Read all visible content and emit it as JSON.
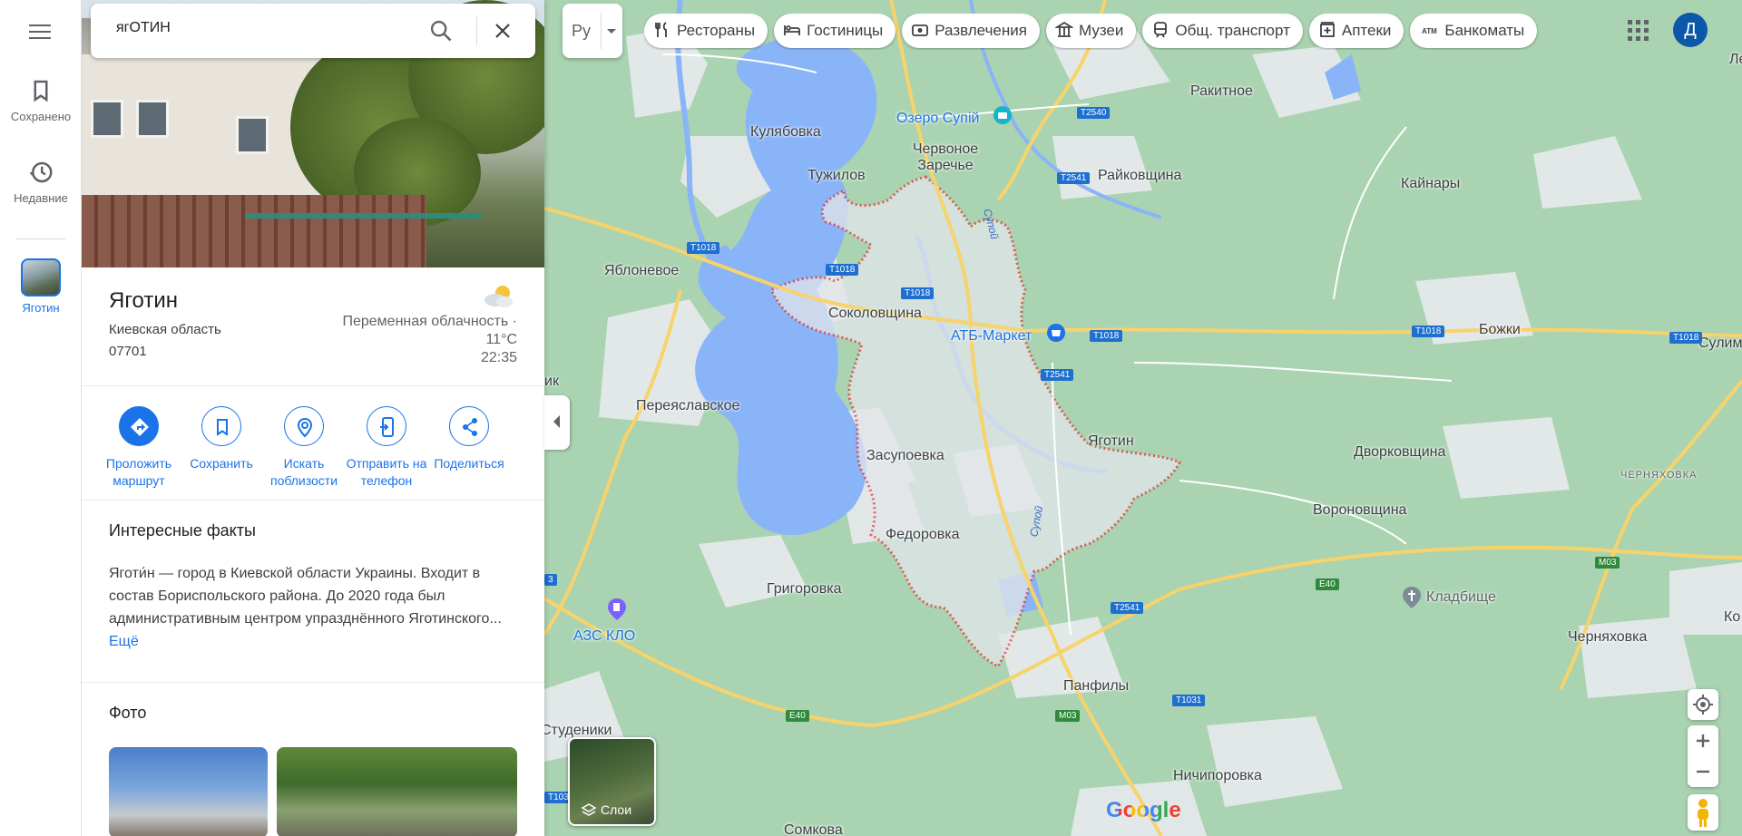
{
  "search": {
    "value": "ягОТИН"
  },
  "rail": {
    "saved_label": "Сохранено",
    "recent_label": "Недавние",
    "place_label": "Яготин"
  },
  "place": {
    "name": "Яготин",
    "region": "Киевская область",
    "postal_code": "07701",
    "weather_text": "Переменная облачность · 11°C",
    "time": "22:35"
  },
  "actions": [
    {
      "label": "Проложить маршрут",
      "icon": "directions-icon"
    },
    {
      "label": "Сохранить",
      "icon": "bookmark-icon"
    },
    {
      "label": "Искать поблизости",
      "icon": "nearby-icon"
    },
    {
      "label": "Отправить на телефон",
      "icon": "send-to-phone-icon"
    },
    {
      "label": "Поделиться",
      "icon": "share-icon"
    }
  ],
  "facts": {
    "heading": "Интересные факты",
    "text": "Яготи́н — город в Киевской области Украины. Входит в состав Бориспольского района. До 2020 года был административным центром упразднённого Яготинского...",
    "more": "Ещё"
  },
  "photos": {
    "heading": "Фото"
  },
  "map": {
    "language_button": "Ру",
    "chips": [
      {
        "label": "Рестораны",
        "icon": "restaurant-icon"
      },
      {
        "label": "Гостиницы",
        "icon": "hotel-icon"
      },
      {
        "label": "Развлечения",
        "icon": "ticket-icon"
      },
      {
        "label": "Музеи",
        "icon": "museum-icon"
      },
      {
        "label": "Общ. транспорт",
        "icon": "transit-icon"
      },
      {
        "label": "Аптеки",
        "icon": "pharmacy-icon"
      },
      {
        "label": "Банкоматы",
        "icon": "atm-icon"
      }
    ],
    "atm_icon_text": "ATM",
    "avatar": "Д",
    "layers_label": "Слои",
    "google_logo": "Google",
    "places": [
      "Кулябовка",
      "Тужилов",
      "Червоное Заречье",
      "Ракитное",
      "Райковщина",
      "Кайнары",
      "Яблоневое",
      "Соколовщина",
      "Переяславское",
      "Засупоевка",
      "Яготин",
      "Дворковщина",
      "Вороновщина",
      "Федоровка",
      "Григоровка",
      "Божки",
      "Сулим",
      "Черняховка",
      "Панфилы",
      "Ничипоровка",
      "Сомкова",
      "Студеники",
      "Ко",
      "Ле",
      "ик"
    ],
    "pois": [
      "Озеро Супій",
      "АТБ-Маркет",
      "АЗС КЛО",
      "Кладбище"
    ],
    "river": "Супой",
    "small_label": "ЧЕРНЯХОВКА",
    "roads": [
      "T1018",
      "T2540",
      "T2541",
      "T1031",
      "M03",
      "E40",
      "3",
      "T103"
    ]
  }
}
